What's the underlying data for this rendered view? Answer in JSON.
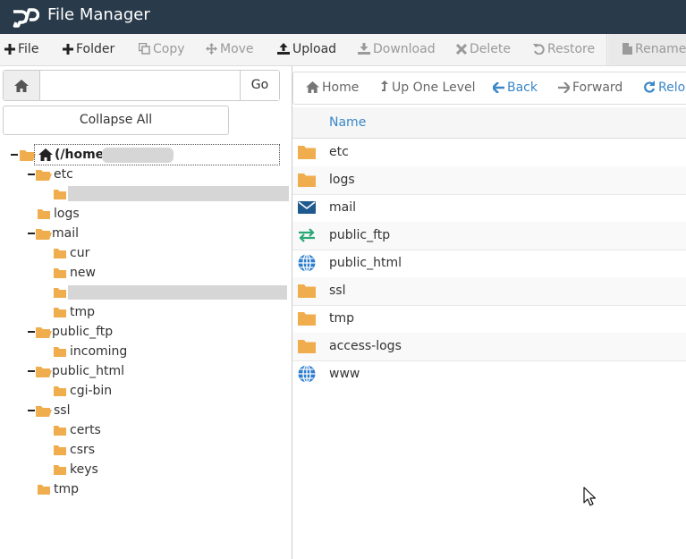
{
  "app": {
    "title": "File Manager"
  },
  "toolbar": {
    "items": [
      {
        "label": "File",
        "icon": "plus-icon",
        "enabled": true
      },
      {
        "label": "Folder",
        "icon": "plus-icon",
        "enabled": true
      },
      {
        "label": "Copy",
        "icon": "copy-icon",
        "enabled": false
      },
      {
        "label": "Move",
        "icon": "move-icon",
        "enabled": false
      },
      {
        "label": "Upload",
        "icon": "upload-icon",
        "enabled": true
      },
      {
        "label": "Download",
        "icon": "download-icon",
        "enabled": false
      },
      {
        "label": "Delete",
        "icon": "delete-icon",
        "enabled": false
      },
      {
        "label": "Restore",
        "icon": "restore-icon",
        "enabled": false
      },
      {
        "label": "Rename",
        "icon": "rename-icon",
        "enabled": false
      }
    ]
  },
  "search": {
    "value": "",
    "go_label": "Go"
  },
  "tree": {
    "collapse_label": "Collapse All",
    "root_label": "(/home/",
    "nodes": [
      {
        "label": "etc"
      },
      {
        "label": "logs"
      },
      {
        "label": "mail"
      },
      {
        "label": "cur"
      },
      {
        "label": "new"
      },
      {
        "label": "tmp"
      },
      {
        "label": "public_ftp"
      },
      {
        "label": "incoming"
      },
      {
        "label": "public_html"
      },
      {
        "label": "cgi-bin"
      },
      {
        "label": "ssl"
      },
      {
        "label": "certs"
      },
      {
        "label": "csrs"
      },
      {
        "label": "keys"
      },
      {
        "label": "tmp"
      }
    ]
  },
  "nav": {
    "home_label": "Home",
    "up_label": "Up One Level",
    "back_label": "Back",
    "forward_label": "Forward",
    "reload_label": "Relo"
  },
  "table": {
    "column_name": "Name",
    "rows": [
      {
        "name": "etc",
        "icon": "folder-icon"
      },
      {
        "name": "logs",
        "icon": "folder-icon"
      },
      {
        "name": "mail",
        "icon": "envelope-icon"
      },
      {
        "name": "public_ftp",
        "icon": "transfer-icon"
      },
      {
        "name": "public_html",
        "icon": "globe-icon"
      },
      {
        "name": "ssl",
        "icon": "folder-icon"
      },
      {
        "name": "tmp",
        "icon": "folder-icon"
      },
      {
        "name": "access-logs",
        "icon": "folder-icon"
      },
      {
        "name": "www",
        "icon": "globe-icon"
      }
    ]
  },
  "colors": {
    "header_bg": "#293a4a",
    "folder": "#f0ad4e",
    "link": "#3a87c8",
    "mail": "#1f5a8f",
    "transfer": "#2aa876",
    "globe": "#2f7fcf"
  }
}
